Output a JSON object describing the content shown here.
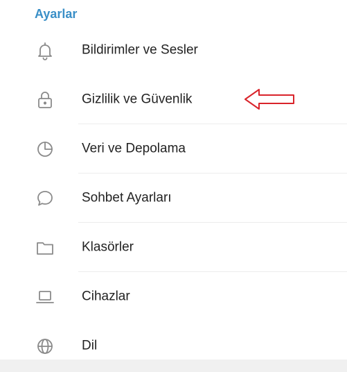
{
  "header": {
    "title": "Ayarlar",
    "accent_color": "#3a8fc7"
  },
  "menu": {
    "items": [
      {
        "label": "Bildirimler ve Sesler",
        "icon": "bell-icon"
      },
      {
        "label": "Gizlilik ve Güvenlik",
        "icon": "lock-icon"
      },
      {
        "label": "Veri ve Depolama",
        "icon": "pie-chart-icon"
      },
      {
        "label": "Sohbet Ayarları",
        "icon": "chat-bubble-icon"
      },
      {
        "label": "Klasörler",
        "icon": "folder-icon"
      },
      {
        "label": "Cihazlar",
        "icon": "laptop-icon"
      },
      {
        "label": "Dil",
        "icon": "globe-icon"
      }
    ]
  },
  "annotation": {
    "arrow_color": "#d9232a",
    "points_to": "Gizlilik ve Güvenlik"
  }
}
